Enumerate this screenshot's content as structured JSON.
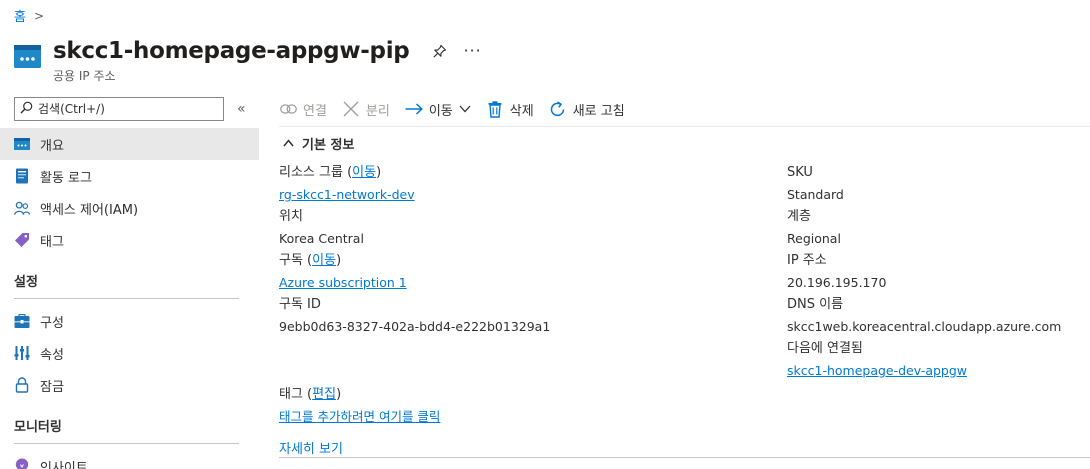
{
  "breadcrumb": {
    "home": "홈",
    "separator": ">"
  },
  "header": {
    "title": "skcc1-homepage-appgw-pip",
    "subtitle": "공용 IP 주소",
    "more": "···"
  },
  "sidebar": {
    "search_placeholder": "검색(Ctrl+/)",
    "collapse": "«",
    "items": [
      {
        "label": "개요",
        "icon": "overview-icon"
      },
      {
        "label": "활동 로그",
        "icon": "activity-log-icon"
      },
      {
        "label": "액세스 제어(IAM)",
        "icon": "iam-icon"
      },
      {
        "label": "태그",
        "icon": "tag-icon"
      }
    ],
    "sections": [
      {
        "title": "설정",
        "items": [
          {
            "label": "구성",
            "icon": "configuration-icon"
          },
          {
            "label": "속성",
            "icon": "properties-icon"
          },
          {
            "label": "잠금",
            "icon": "lock-icon"
          }
        ]
      },
      {
        "title": "모니터링",
        "items": [
          {
            "label": "인사이트",
            "icon": "insights-icon"
          }
        ]
      }
    ]
  },
  "toolbar": {
    "connect": "연결",
    "disconnect": "분리",
    "move": "이동",
    "delete": "삭제",
    "refresh": "새로 고침"
  },
  "essentials": {
    "heading": "기본 정보",
    "left": {
      "resource_group_label": "리소스 그룹",
      "resource_group_move": "이동",
      "resource_group_value": "rg-skcc1-network-dev",
      "location_label": "위치",
      "location_value": "Korea Central",
      "subscription_label": "구독",
      "subscription_move": "이동",
      "subscription_value": "Azure subscription 1",
      "subscription_id_label": "구독 ID",
      "subscription_id_value": "9ebb0d63-8327-402a-bdd4-e222b01329a1"
    },
    "right": {
      "sku_label": "SKU",
      "sku_value": "Standard",
      "tier_label": "계층",
      "tier_value": "Regional",
      "ip_label": "IP 주소",
      "ip_value": "20.196.195.170",
      "dns_label": "DNS 이름",
      "dns_value": "skcc1web.koreacentral.cloudapp.azure.com",
      "associated_label": "다음에 연결됨",
      "associated_value": "skcc1-homepage-dev-appgw"
    },
    "tags_label": "태그",
    "tags_edit": "편집",
    "tags_add": "태그를 추가하려면 여기를 클릭",
    "see_more": "자세히 보기"
  },
  "colors": {
    "accent": "#0078d4",
    "selected_bg": "#e8e8e8"
  }
}
